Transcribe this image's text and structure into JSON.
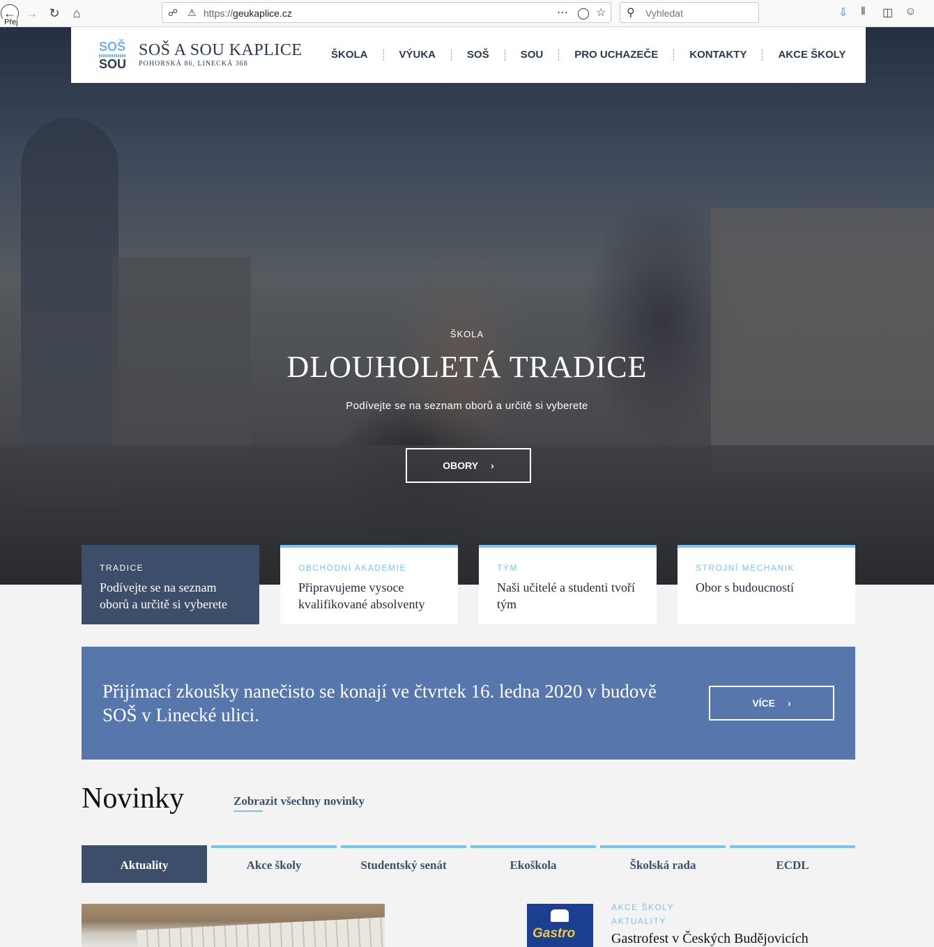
{
  "browser": {
    "url_scheme": "https://",
    "url_host": "geukaplice.cz",
    "search_placeholder": "Vyhledat",
    "tooltip": "Přej"
  },
  "header": {
    "logo_top": "SOŠ",
    "logo_bottom": "SOU",
    "brand": "SOŠ A SOU KAPLICE",
    "address": "POHORSKÁ 86, LINECKÁ 368",
    "nav": [
      "ŠKOLA",
      "VÝUKA",
      "SOŠ",
      "SOU",
      "PRO UCHAZEČE",
      "KONTAKTY",
      "AKCE ŠKOLY"
    ]
  },
  "hero": {
    "eyebrow": "ŠKOLA",
    "title": "DLOUHOLETÁ TRADICE",
    "subtitle": "Podívejte se na seznam oborů a určitě si vyberete",
    "button": "OBORY",
    "button_icon": "chevron-right-icon"
  },
  "cards": [
    {
      "caption": "TRADICE",
      "text": "Podívejte se na seznam oborů a určitě si vyberete"
    },
    {
      "caption": "OBCHODNÍ AKADEMIE",
      "text": "Připravujeme vysoce kvalifikované absolventy"
    },
    {
      "caption": "TÝM",
      "text": "Naši učitelé a studenti tvoří tým"
    },
    {
      "caption": "STROJNÍ MECHANIK",
      "text": "Obor s budoucností"
    }
  ],
  "banner": {
    "message": "Přijímací zkoušky nanečisto se konají ve čtvrtek 16. ledna 2020 v budově SOŠ v Linecké ulici.",
    "button": "VÍCE"
  },
  "news": {
    "title": "Novinky",
    "all_link": "Zobrazit všechny novinky",
    "tabs": [
      "Aktuality",
      "Akce školy",
      "Studentský senát",
      "Ekoškola",
      "Školská rada",
      "ECDL"
    ],
    "active_tab": "Aktuality",
    "item": {
      "categories": [
        "AKCE ŠKOLY",
        "AKTUALITY"
      ],
      "title": "Gastrofest v Českých Budějovicích",
      "thumb_text": "Gastro"
    }
  },
  "colors": {
    "navy": "#3d4e6b",
    "accent_blue": "#7dc2ea",
    "banner_blue": "#5777ac"
  }
}
